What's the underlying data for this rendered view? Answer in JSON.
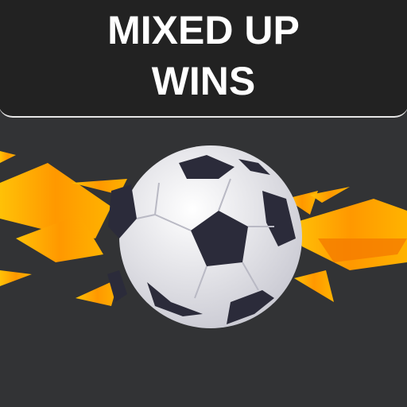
{
  "title": {
    "line1": "MIXED UP",
    "line2": "WINS"
  },
  "art": {
    "icon": "soccer-ball-icon",
    "accent_colors": [
      "#ffc107",
      "#ff9800",
      "#f57c00"
    ],
    "ball_panel_color": "#2b2b3a"
  }
}
